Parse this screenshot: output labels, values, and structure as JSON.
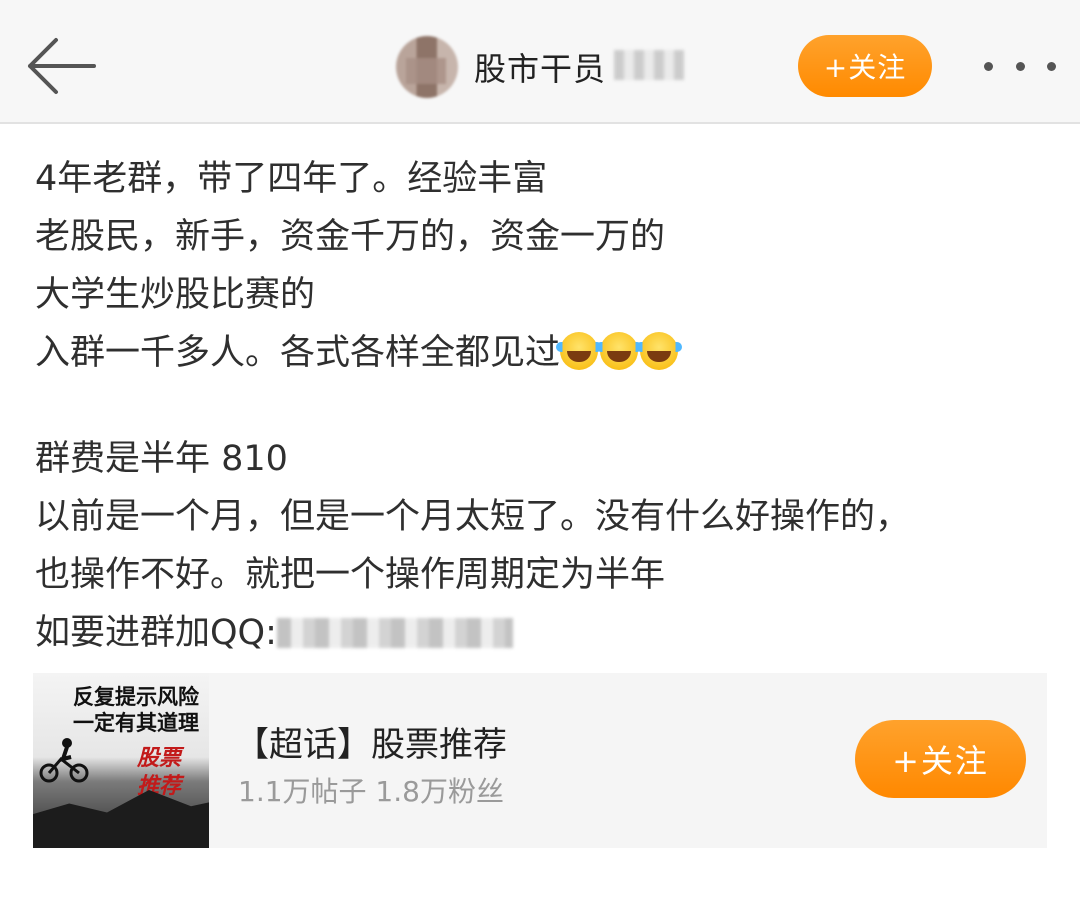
{
  "header": {
    "username": "股市干员",
    "follow_label": "+关注",
    "back_icon": "arrow-left-icon",
    "more_icon": "more-dots-icon"
  },
  "post": {
    "lines": [
      "4年老群，带了四年了。经验丰富",
      "老股民，新手，资金千万的，资金一万的",
      "大学生炒股比赛的",
      "入群一千多人。各式各样全都见过"
    ],
    "emoji_name": "laugh-cry-emoji",
    "lines2": [
      "群费是半年 810",
      "以前是一个月，但是一个月太短了。没有什么好操作的，",
      "也操作不好。就把一个操作周期定为半年"
    ],
    "qq_label": "如要进群加QQ:"
  },
  "topic_card": {
    "thumb_line1": "反复提示风险",
    "thumb_line2": "一定有其道理",
    "thumb_line3": "股票推荐",
    "title": "【超话】股票推荐",
    "stats": "1.1万帖子 1.8万粉丝",
    "follow_label": "+关注"
  },
  "colors": {
    "accent": "#ff9a1a",
    "topbar_bg": "#f7f7f7",
    "card_bg": "#f5f5f5"
  }
}
